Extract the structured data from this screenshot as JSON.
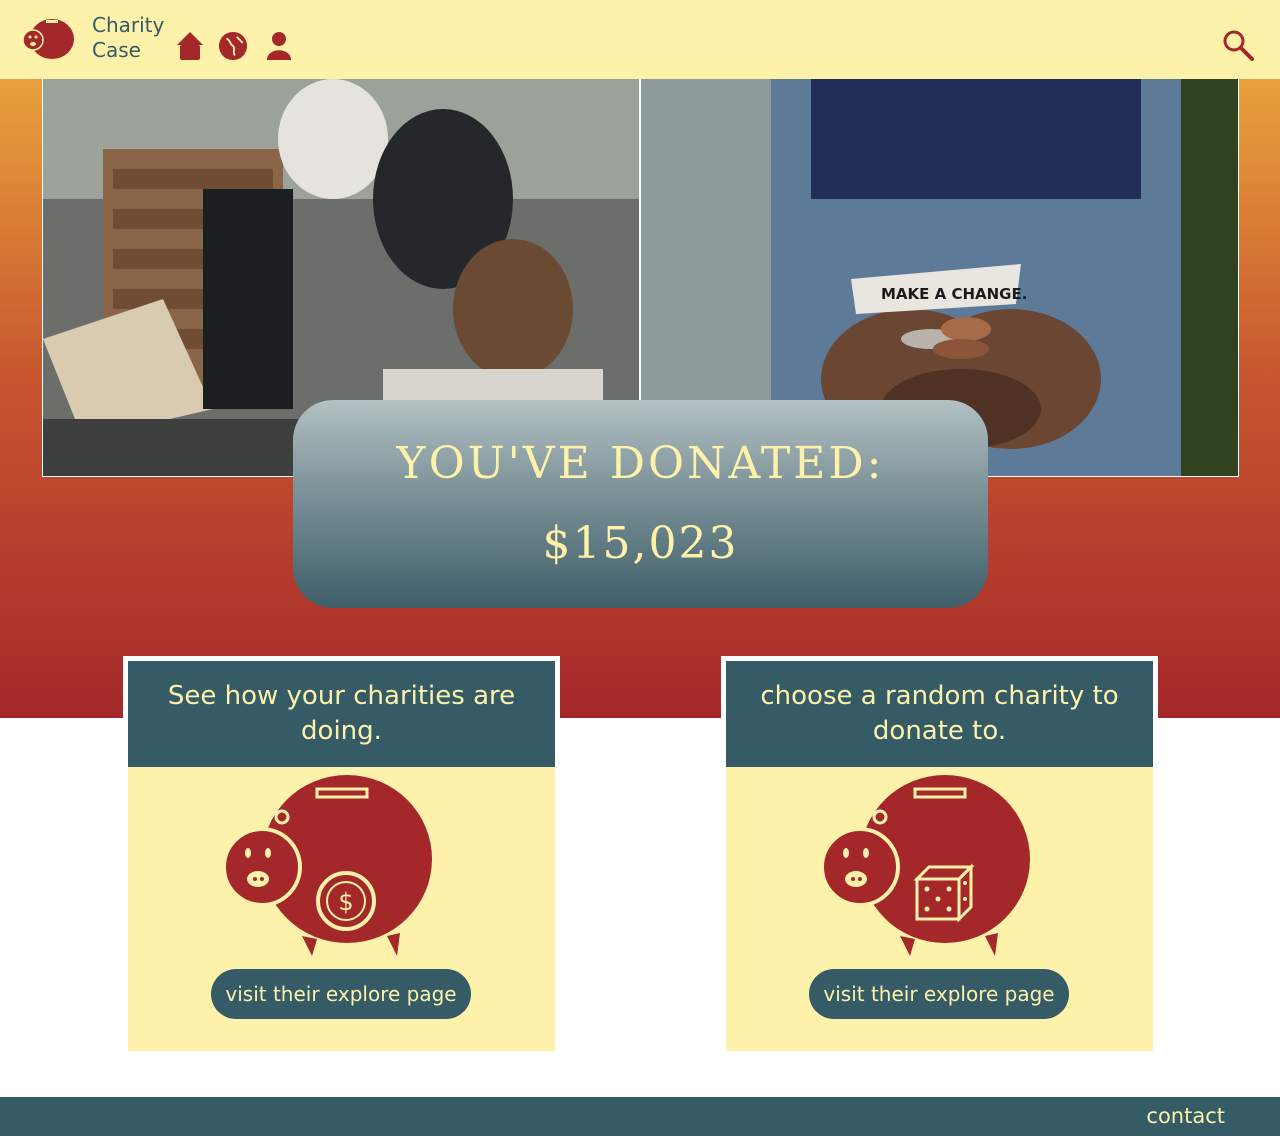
{
  "header": {
    "brand_line1": "Charity",
    "brand_line2": "Case",
    "nav_icons": [
      "home-icon",
      "globe-icon",
      "profile-icon"
    ],
    "search_icon": "search-icon"
  },
  "hero": {
    "photo_left_alt": "volunteers unloading boxes",
    "photo_right_text": "MAKE A CHANGE.",
    "donated_title": "YOU'VE DONATED:",
    "donated_amount": "$15,023"
  },
  "cards": [
    {
      "heading": "See how your charities are doing.",
      "button": "visit their explore page",
      "icon": "piggy-bank-dollar-icon"
    },
    {
      "heading": "choose a random charity to donate to.",
      "button": "visit their explore page",
      "icon": "piggy-bank-dice-icon"
    }
  ],
  "footer": {
    "contact": "contact"
  },
  "colors": {
    "cream": "#fef2ab",
    "teal": "#355b66",
    "red": "#a4282a",
    "orange": "#e9a13c"
  }
}
